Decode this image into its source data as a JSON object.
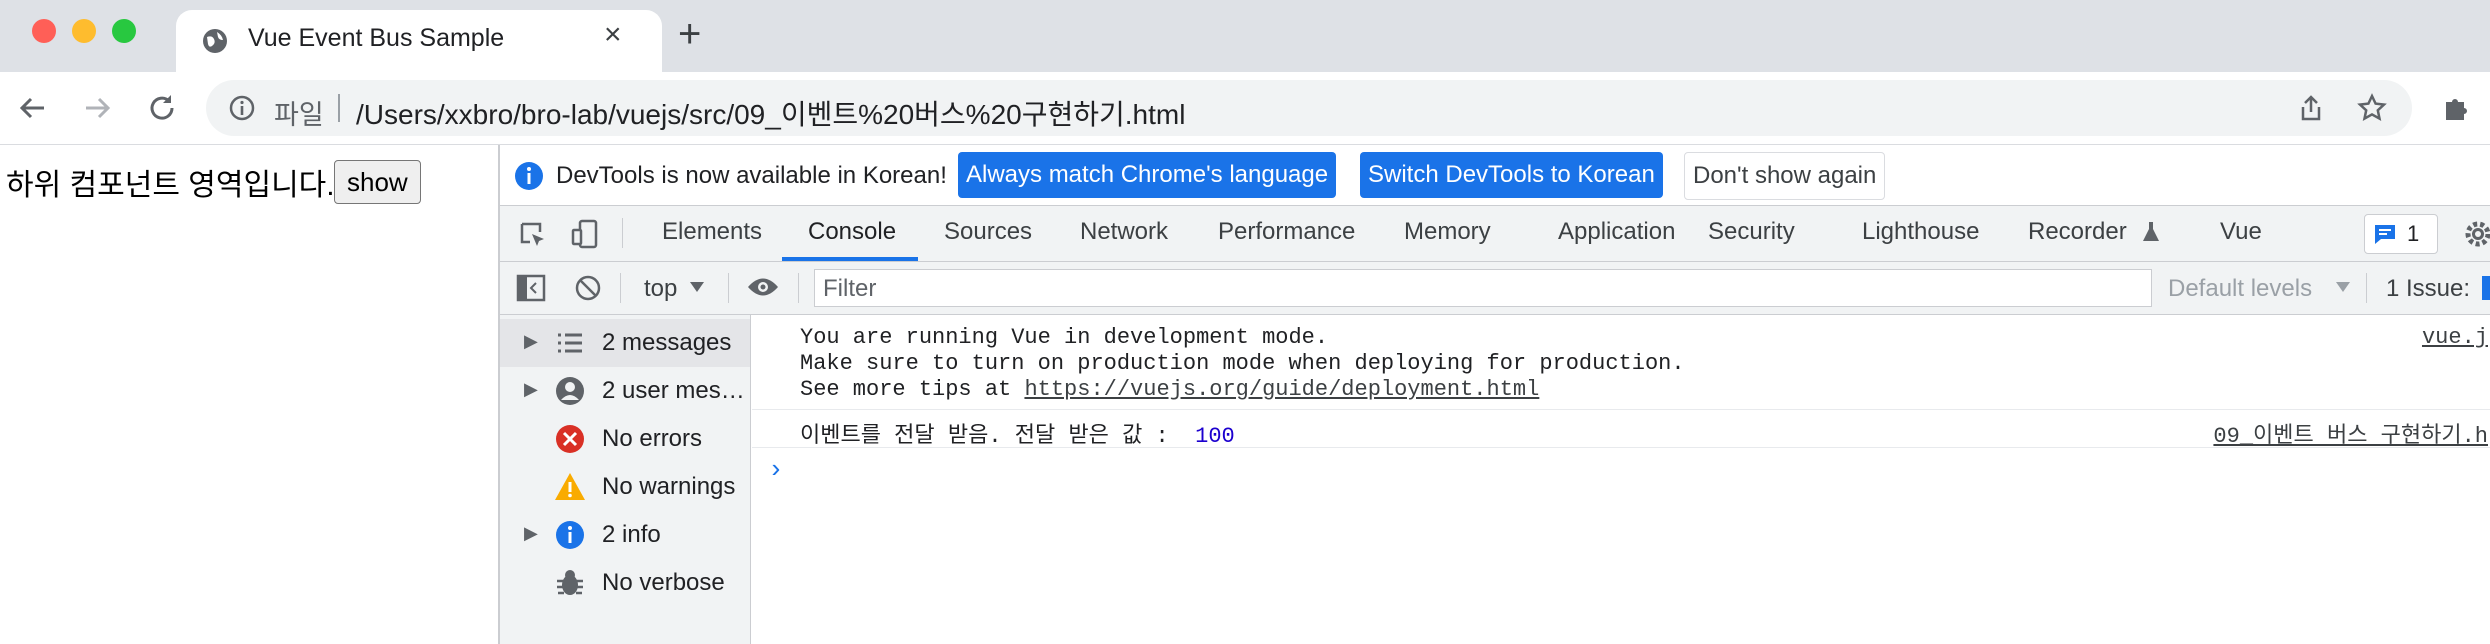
{
  "browser": {
    "tab_title": "Vue Event Bus Sample",
    "tab_close": "×",
    "new_tab": "+",
    "file_label": "파일",
    "url": "/Users/xxbro/bro-lab/vuejs/src/09_이벤트%20버스%20구현하기.html",
    "traffic_colors": {
      "close": "#ff5f57",
      "minimize": "#febc2e",
      "zoom": "#28c840"
    }
  },
  "page": {
    "text": "하위 컴포넌트 영역입니다.",
    "button": "show"
  },
  "devtools": {
    "infobar": {
      "message": "DevTools is now available in Korean!",
      "btn_match": "Always match Chrome's language",
      "btn_switch": "Switch DevTools to Korean",
      "btn_dismiss": "Don't show again"
    },
    "tabs": [
      "Elements",
      "Console",
      "Sources",
      "Network",
      "Performance",
      "Memory",
      "Application",
      "Security",
      "Lighthouse",
      "Recorder",
      "Vue"
    ],
    "active_tab": "Console",
    "issues_badge": "1",
    "console": {
      "context": "top",
      "filter_placeholder": "Filter",
      "levels": "Default levels",
      "issues": "1 Issue:"
    },
    "sidebar": [
      {
        "label": "2 messages",
        "icon": "list-icon"
      },
      {
        "label": "2 user mes…",
        "icon": "user-icon"
      },
      {
        "label": "No errors",
        "icon": "error-icon"
      },
      {
        "label": "No warnings",
        "icon": "warning-icon"
      },
      {
        "label": "2 info",
        "icon": "info-icon"
      },
      {
        "label": "No verbose",
        "icon": "bug-icon"
      }
    ],
    "log": {
      "line1": "You are running Vue in development mode.",
      "line2": "Make sure to turn on production mode when deploying for production.",
      "line3_prefix": "See more tips at ",
      "line3_link": "https://vuejs.org/guide/deployment.html",
      "src1": "vue.j",
      "event_text": "이벤트를 전달 받음. 전달 받은 값 :  ",
      "event_value": "100",
      "src2": "09_이벤트 버스 구현하기.h",
      "prompt": "›"
    }
  }
}
